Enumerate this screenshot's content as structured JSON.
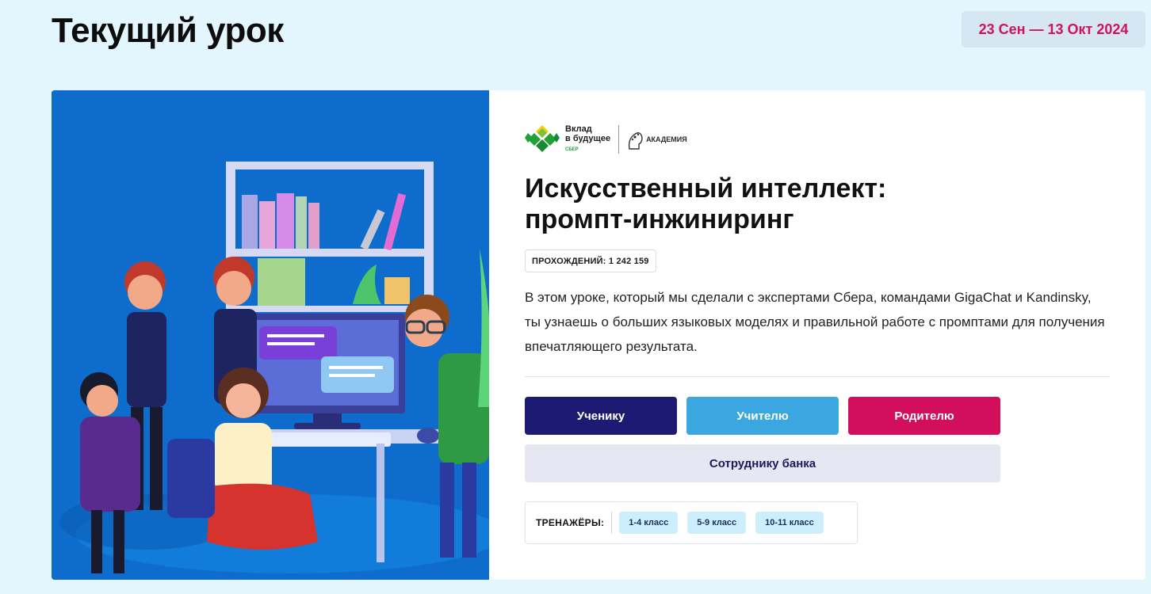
{
  "header": {
    "title": "Текущий урок",
    "date_range": "23 Сен — 13 Окт 2024"
  },
  "lesson": {
    "logo_text_line1": "Вклад",
    "logo_text_line2": "в будущее",
    "logo_sber": "СБЕР",
    "logo_academy": "АКАДЕМИЯ",
    "title_line1": "Искусственный интеллект:",
    "title_line2": "промпт-инжиниринг",
    "passes": "ПРОХОЖДЕНИЙ: 1 242 159",
    "description": "В этом уроке, который мы сделали с экспертами Сбера, командами GigaChat и Kandinsky, ты узнаешь о больших языковых моделях и правильной работе с промптами для получения впечатляющего результата.",
    "buttons": {
      "student": "Ученику",
      "teacher": "Учителю",
      "parent": "Родителю",
      "bank": "Сотруднику банка"
    },
    "trainers": {
      "label": "ТРЕНАЖЁРЫ:",
      "chips": [
        "1-4 класс",
        "5-9 класс",
        "10-11 класс"
      ]
    }
  },
  "colors": {
    "background": "#e4f6fd",
    "accent_pink": "#d10f5d",
    "navy": "#1c1a72",
    "sky": "#3ba7e0"
  }
}
